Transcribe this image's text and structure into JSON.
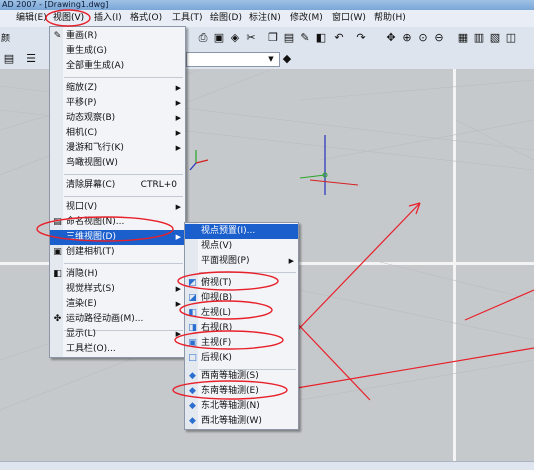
{
  "window": {
    "title": "AD 2007 - [Drawing1.dwg]"
  },
  "menubar": {
    "items": [
      {
        "label": "编辑(E)"
      },
      {
        "label": "视图(V)"
      },
      {
        "label": "插入(I)"
      },
      {
        "label": "格式(O)"
      },
      {
        "label": "工具(T)"
      },
      {
        "label": "绘图(D)"
      },
      {
        "label": "标注(N)"
      },
      {
        "label": "修改(M)"
      },
      {
        "label": "窗口(W)"
      },
      {
        "label": "帮助(H)"
      }
    ]
  },
  "toolbar": {
    "left_text": "颜"
  },
  "view_menu": {
    "items": [
      {
        "label": "重画(R)"
      },
      {
        "label": "重生成(G)"
      },
      {
        "label": "全部重生成(A)"
      },
      {
        "label": "缩放(Z)"
      },
      {
        "label": "平移(P)"
      },
      {
        "label": "动态观察(B)"
      },
      {
        "label": "相机(C)"
      },
      {
        "label": "漫游和飞行(K)"
      },
      {
        "label": "鸟瞰视图(W)"
      },
      {
        "label": "清除屏幕(C)",
        "shortcut": "CTRL+0"
      },
      {
        "label": "视口(V)"
      },
      {
        "label": "命名视图(N)..."
      },
      {
        "label": "三维视图(D)"
      },
      {
        "label": "创建相机(T)"
      },
      {
        "label": "消隐(H)"
      },
      {
        "label": "视觉样式(S)"
      },
      {
        "label": "渲染(E)"
      },
      {
        "label": "运动路径动画(M)..."
      },
      {
        "label": "显示(L)"
      },
      {
        "label": "工具栏(O)..."
      }
    ]
  },
  "threed_menu": {
    "items": [
      {
        "label": "视点预置(I)..."
      },
      {
        "label": "视点(V)"
      },
      {
        "label": "平面视图(P)"
      },
      {
        "label": "俯视(T)"
      },
      {
        "label": "仰视(B)"
      },
      {
        "label": "左视(L)"
      },
      {
        "label": "右视(R)"
      },
      {
        "label": "主视(F)"
      },
      {
        "label": "后视(K)"
      },
      {
        "label": "西南等轴测(S)"
      },
      {
        "label": "东南等轴测(E)"
      },
      {
        "label": "东北等轴测(N)"
      },
      {
        "label": "西北等轴测(W)"
      }
    ]
  },
  "colors": {
    "highlight": "#1b5fcc",
    "annotation": "#e8202a",
    "ucs_blue": "#2233bb"
  }
}
